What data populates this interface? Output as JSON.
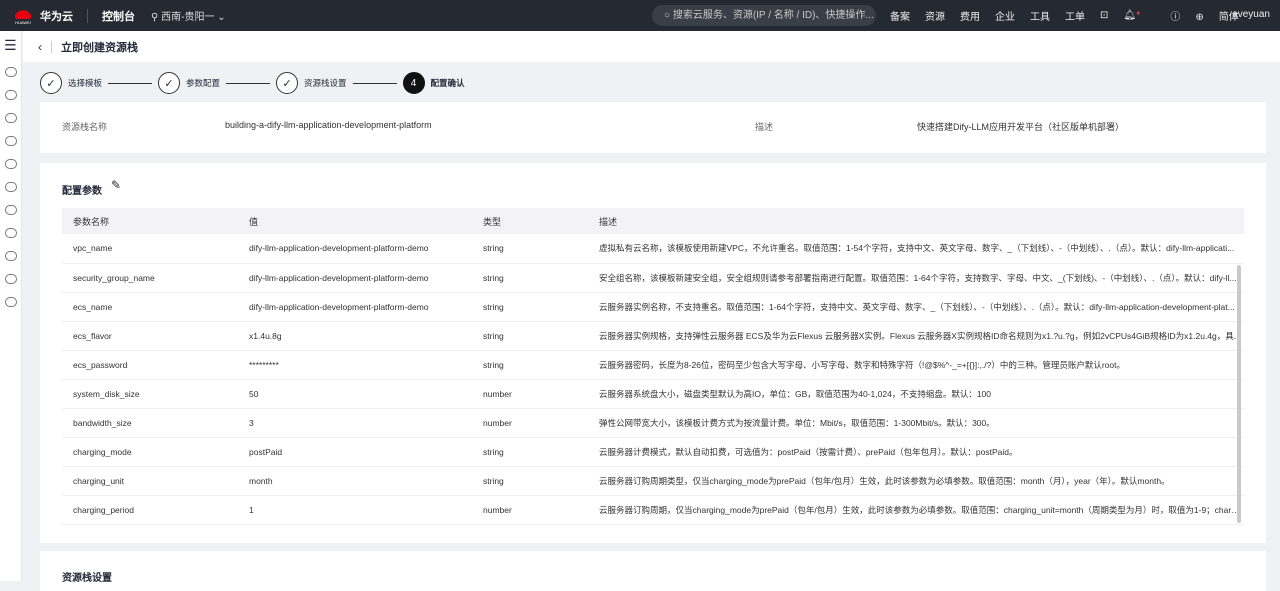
{
  "topbar": {
    "logo_text": "HUAWEI",
    "brand": "华为云",
    "console": "控制台",
    "region": "西南-贵阳一",
    "search_placeholder": "搜索云服务、资源(IP / 名称 / ID)、快捷操作...",
    "nav": [
      "备案",
      "资源",
      "费用",
      "企业",
      "工具",
      "工单"
    ],
    "language": "简体",
    "user": "aveyuan"
  },
  "header": {
    "title": "立即创建资源栈"
  },
  "steps": [
    {
      "label": "选择模板",
      "done": true
    },
    {
      "label": "参数配置",
      "done": true
    },
    {
      "label": "资源栈设置",
      "done": true
    },
    {
      "label": "配置确认",
      "number": "4",
      "done": false
    }
  ],
  "summary": {
    "name_label": "资源栈名称",
    "name_value": "building-a-dify-llm-application-development-platform",
    "desc_label": "描述",
    "desc_value": "快速搭建Dify-LLM应用开发平台（社区版单机部署）"
  },
  "params": {
    "title": "配置参数",
    "columns": [
      "参数名称",
      "值",
      "类型",
      "描述"
    ],
    "rows": [
      [
        "vpc_name",
        "dify-llm-application-development-platform-demo",
        "string",
        "虚拟私有云名称，该模板使用新建VPC，不允许重名。取值范围：1-54个字符，支持中文、英文字母、数字、_（下划线）、-（中划线）、.（点）。默认：dify-llm-applicati..."
      ],
      [
        "security_group_name",
        "dify-llm-application-development-platform-demo",
        "string",
        "安全组名称，该模板新建安全组，安全组规则请参考部署指南进行配置。取值范围：1-64个字符，支持数字、字母、中文、_(下划线)、-（中划线）、.（点）。默认：dify-ll..."
      ],
      [
        "ecs_name",
        "dify-llm-application-development-platform-demo",
        "string",
        "云服务器实例名称，不支持重名。取值范围：1-64个字符，支持中文、英文字母、数字、_（下划线）、-（中划线）、.（点）。默认：dify-llm-application-development-plat..."
      ],
      [
        "ecs_flavor",
        "x1.4u.8g",
        "string",
        "云服务器实例规格，支持弹性云服务器 ECS及华为云Flexus 云服务器X实例。Flexus 云服务器X实例规格ID命名规则为x1.?u.?g，例如2vCPUs4GiB规格ID为x1.2u.4g，具..."
      ],
      [
        "ecs_password",
        "*********",
        "string",
        "云服务器密码，长度为8-26位，密码至少包含大写字母、小写字母、数字和特殊字符（!@$%^-_=+[{}]:,./?）中的三种。管理员账户默认root。"
      ],
      [
        "system_disk_size",
        "50",
        "number",
        "云服务器系统盘大小，磁盘类型默认为高IO，单位：GB，取值范围为40-1,024，不支持缩盘。默认：100"
      ],
      [
        "bandwidth_size",
        "3",
        "number",
        "弹性公网带宽大小，该模板计费方式为按流量计费。单位：Mbit/s，取值范围：1-300Mbit/s。默认：300。"
      ],
      [
        "charging_mode",
        "postPaid",
        "string",
        "云服务器计费模式，默认自动扣费，可选值为：postPaid（按需计费）、prePaid（包年包月）。默认：postPaid。"
      ],
      [
        "charging_unit",
        "month",
        "string",
        "云服务器订购周期类型，仅当charging_mode为prePaid（包年/包月）生效，此时该参数为必填参数。取值范围：month（月），year（年）。默认month。"
      ],
      [
        "charging_period",
        "1",
        "number",
        "云服务器订购周期，仅当charging_mode为prePaid（包年/包月）生效，此时该参数为必填参数。取值范围：charging_unit=month（周期类型为月）时，取值为1-9；chargi..."
      ]
    ]
  },
  "stack_settings": {
    "title": "资源栈设置"
  }
}
